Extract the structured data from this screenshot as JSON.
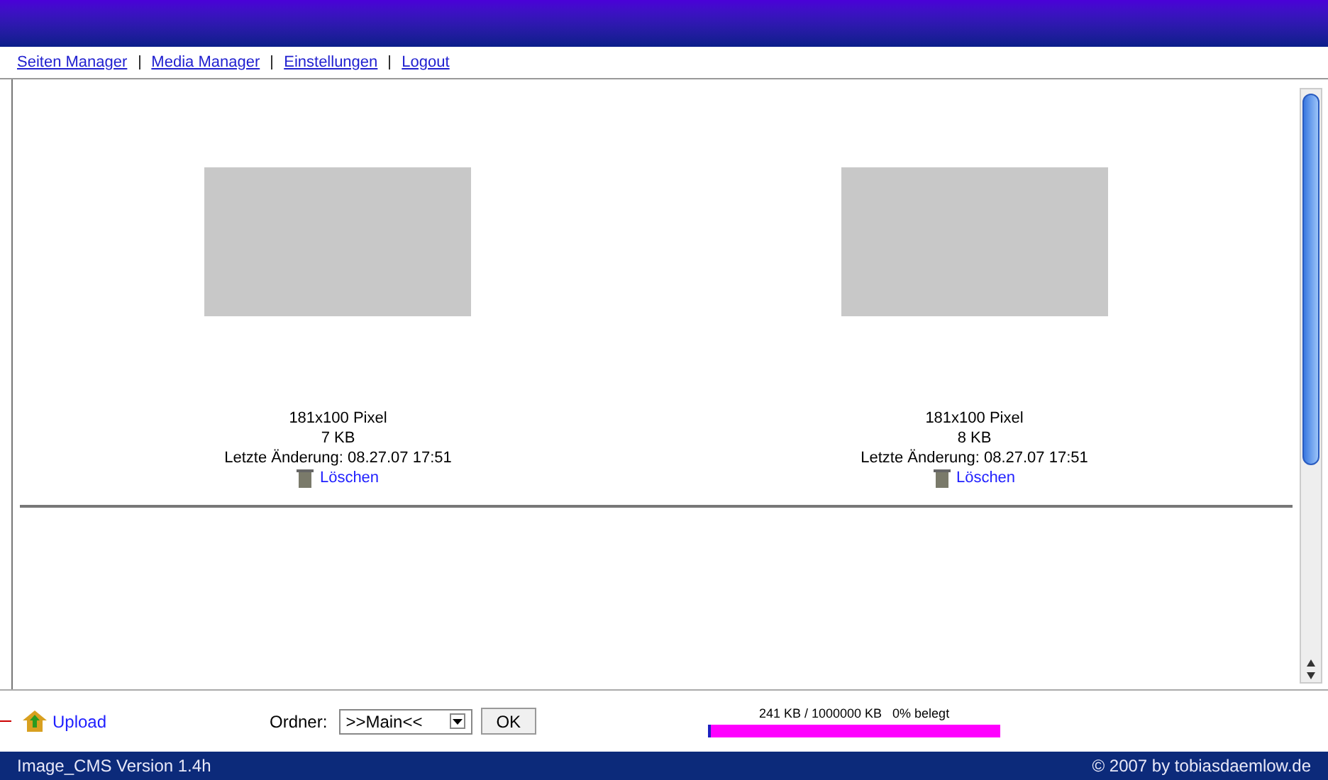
{
  "nav": [
    "Seiten Manager",
    "Media Manager",
    "Einstellungen",
    "Logout"
  ],
  "images": [
    {
      "size": "181x100 Pixel",
      "filesize": "7 KB",
      "modified": "Letzte Änderung: 08.27.07 17:51",
      "delete": "Löschen"
    },
    {
      "size": "181x100 Pixel",
      "filesize": "8 KB",
      "modified": "Letzte Änderung: 08.27.07 17:51",
      "delete": "Löschen"
    }
  ],
  "upload": "Upload",
  "folder": {
    "label": "Ordner:",
    "value": ">>Main<<",
    "ok": "OK"
  },
  "usage": {
    "text": "241 KB / 1000000 KB   0% belegt",
    "level": 0.01
  },
  "footer": {
    "version": "Image_CMS Version 1.4h",
    "copyright": "© 2007 by tobiasdaemlow.de"
  }
}
